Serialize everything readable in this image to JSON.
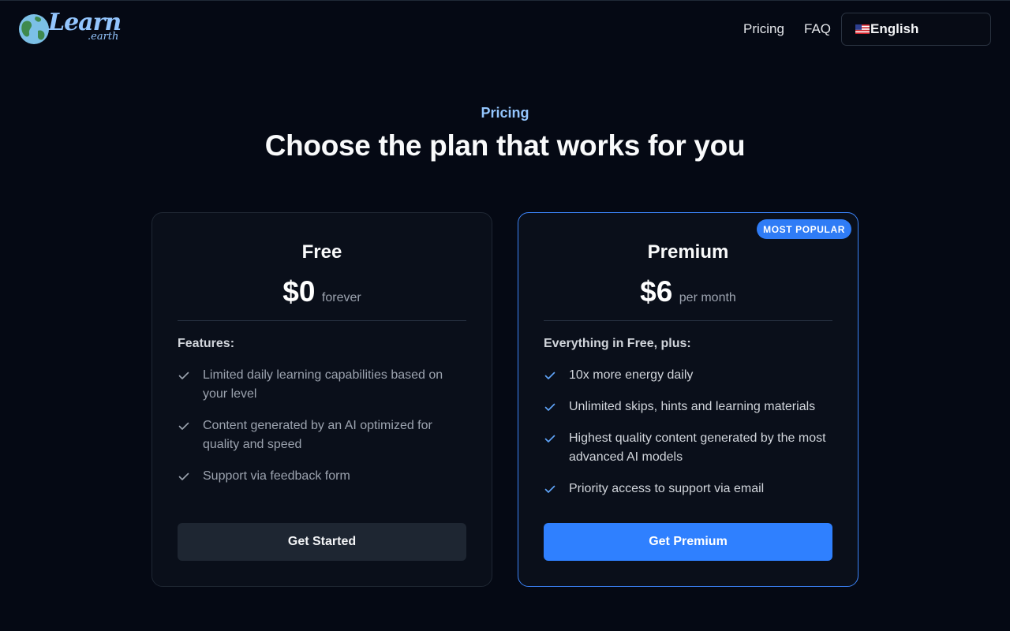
{
  "brand": {
    "name": "Learn",
    "suffix": ".earth"
  },
  "nav": {
    "links": [
      "Pricing",
      "FAQ"
    ],
    "language": {
      "selected": "English",
      "flag": "us-flag-icon"
    }
  },
  "hero": {
    "eyebrow": "Pricing",
    "headline": "Choose the plan that works for you"
  },
  "plans": [
    {
      "name": "Free",
      "price": "$0",
      "period": "forever",
      "features_title": "Features:",
      "features": [
        "Limited daily learning capabilities based on your level",
        "Content generated by an AI optimized for quality and speed",
        "Support via feedback form"
      ],
      "cta": "Get Started"
    },
    {
      "name": "Premium",
      "badge": "MOST POPULAR",
      "price": "$6",
      "period": "per month",
      "features_title": "Everything in Free, plus:",
      "features": [
        "10x more energy daily",
        "Unlimited skips, hints and learning materials",
        "Highest quality content generated by the most advanced AI models",
        "Priority access to support via email"
      ],
      "cta": "Get Premium"
    }
  ],
  "colors": {
    "background": "#050914",
    "accent": "#2f80ff",
    "accent_light": "#93c5fd",
    "card": "#0a0f1a",
    "premium_border": "#3b82f6"
  }
}
